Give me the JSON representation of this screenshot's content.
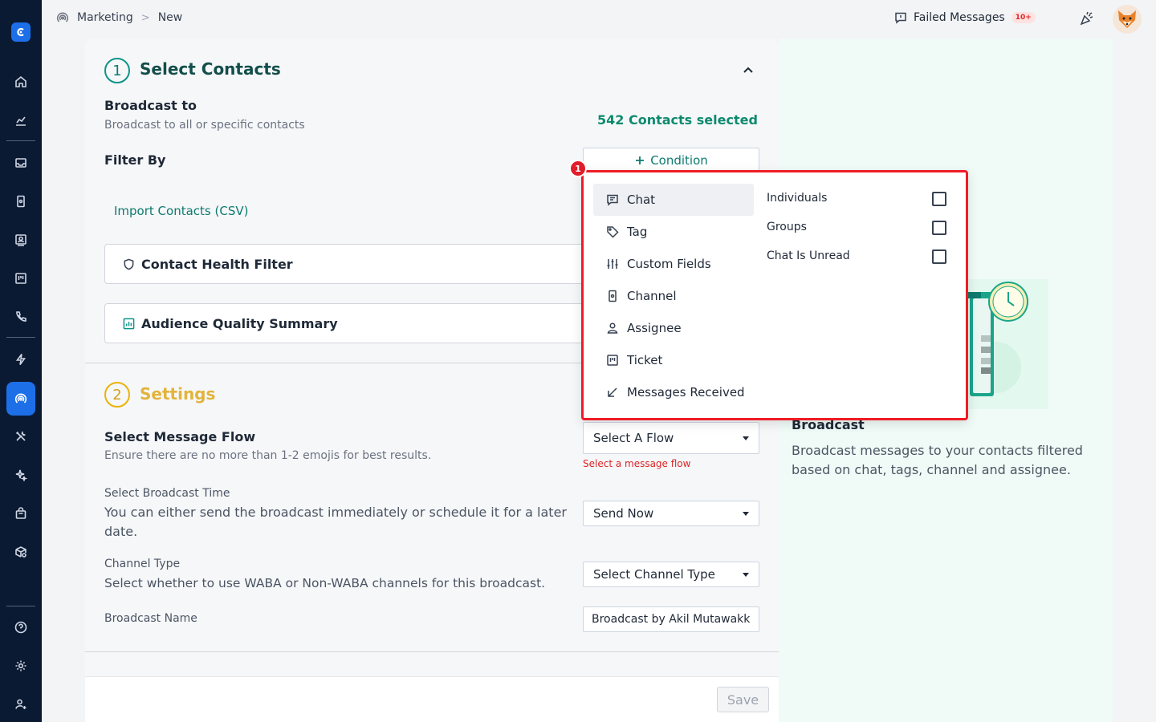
{
  "topbar": {
    "breadcrumb": [
      "Marketing",
      "New"
    ],
    "crumb_separator": ">",
    "failed_messages_label": "Failed Messages",
    "failed_messages_badge": "10+"
  },
  "step1": {
    "number": "1",
    "title": "Select Contacts",
    "broadcast_to_title": "Broadcast to",
    "broadcast_to_desc": "Broadcast to all or specific contacts",
    "contacts_selected": "542 Contacts selected",
    "filter_by": "Filter By",
    "condition_button": "Condition",
    "import_contacts": "Import Contacts (CSV)",
    "contact_health_filter": "Contact Health Filter",
    "audience_quality_summary": "Audience Quality Summary"
  },
  "step2": {
    "number": "2",
    "title": "Settings",
    "message_flow_title": "Select Message Flow",
    "message_flow_desc": "Ensure there are no more than 1-2 emojis for best results.",
    "message_flow_select": "Select A Flow",
    "message_flow_error": "Select a message flow",
    "broadcast_time_title": "Select Broadcast Time",
    "broadcast_time_desc": "You can either send the broadcast immediately or schedule it for a later date.",
    "broadcast_time_select": "Send Now",
    "channel_type_title": "Channel Type",
    "channel_type_desc": "Select whether to use WABA or Non-WABA channels for this broadcast.",
    "channel_type_select": "Select Channel Type",
    "broadcast_name_title": "Broadcast Name",
    "broadcast_name_value": "Broadcast by Akil Mutawakkil"
  },
  "footer": {
    "save_label": "Save"
  },
  "right_panel": {
    "title": "Broadcast",
    "description": "Broadcast messages to your contacts filtered based on chat, tags, channel and assignee."
  },
  "dropdown": {
    "marker": "1",
    "menu": [
      {
        "label": "Chat",
        "icon": "chat-icon",
        "active": true
      },
      {
        "label": "Tag",
        "icon": "tag-icon"
      },
      {
        "label": "Custom Fields",
        "icon": "sliders-icon"
      },
      {
        "label": "Channel",
        "icon": "channel-icon"
      },
      {
        "label": "Assignee",
        "icon": "user-icon"
      },
      {
        "label": "Ticket",
        "icon": "ticket-icon"
      },
      {
        "label": "Messages Received",
        "icon": "arrow-down-left-icon"
      }
    ],
    "options": [
      {
        "label": "Individuals",
        "checked": false
      },
      {
        "label": "Groups",
        "checked": false
      },
      {
        "label": "Chat Is Unread",
        "checked": false
      }
    ]
  },
  "colors": {
    "sidebar_bg": "#0b1a33",
    "accent_blue": "#1d6fe8",
    "brand_green": "#0d7a6e",
    "settings_yellow": "#e2b43c",
    "error_red": "#dc2626",
    "highlight_red": "#ef1c25"
  }
}
